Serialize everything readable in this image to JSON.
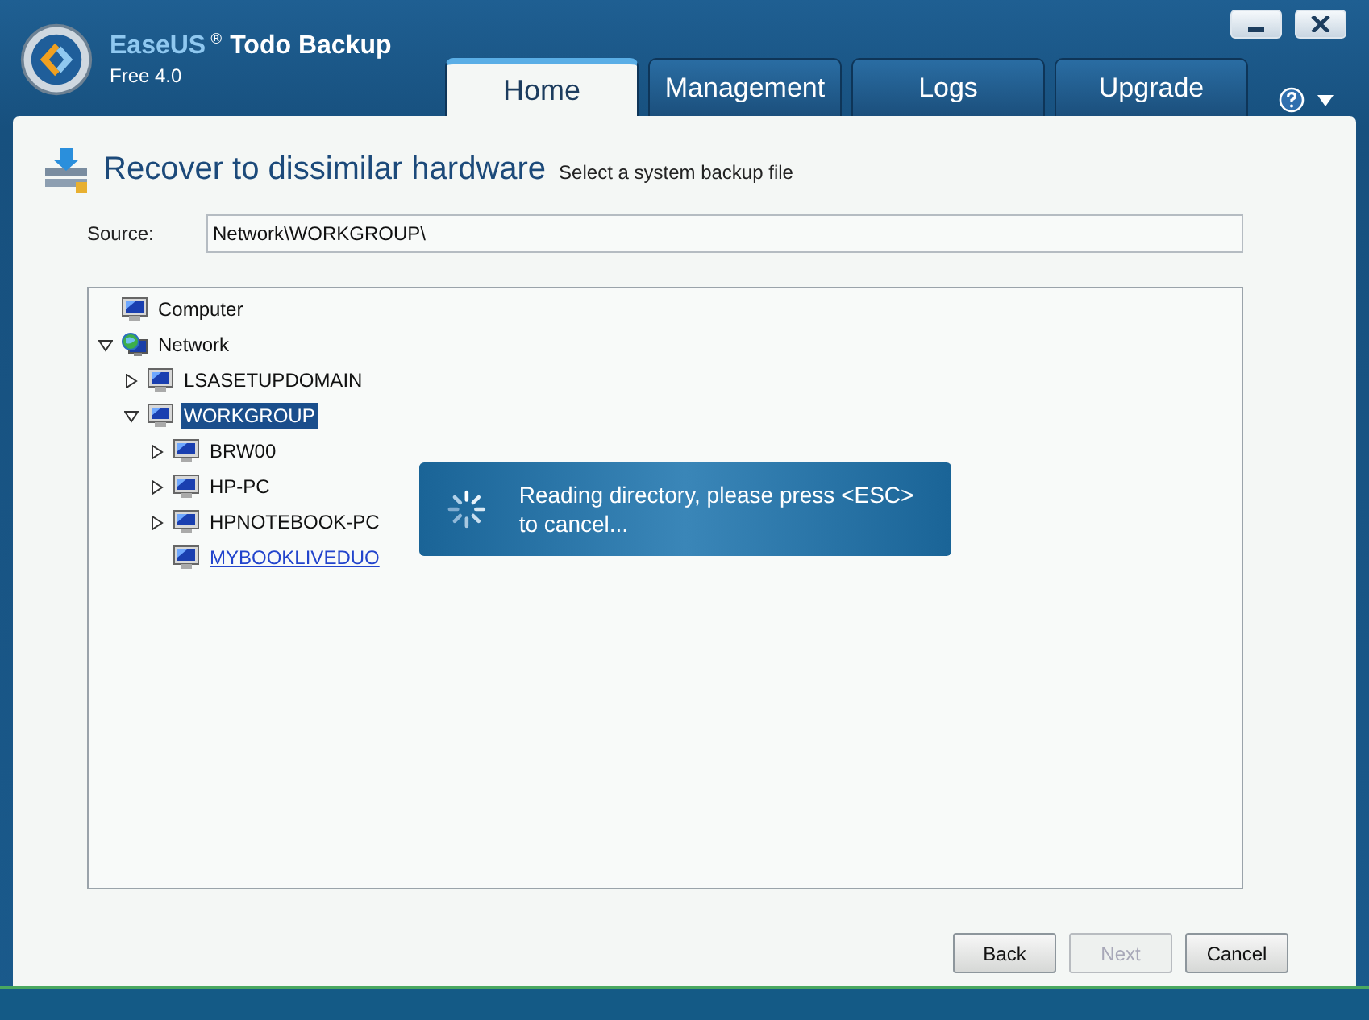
{
  "app": {
    "brand": "EaseUS",
    "product": "Todo Backup",
    "mark": "®",
    "edition": "Free 4.0"
  },
  "tabs": [
    {
      "label": "Home",
      "selected": true
    },
    {
      "label": "Management",
      "selected": false
    },
    {
      "label": "Logs",
      "selected": false
    },
    {
      "label": "Upgrade",
      "selected": false
    }
  ],
  "page": {
    "title": "Recover to dissimilar hardware",
    "subtitle": "Select a system backup file"
  },
  "source": {
    "label": "Source:",
    "value": "Network\\WORKGROUP\\"
  },
  "tree": [
    {
      "label": "Computer",
      "kind": "computer",
      "selected": false
    },
    {
      "label": "Network",
      "kind": "network",
      "selected": false,
      "expanded": true,
      "children": [
        {
          "label": "LSASETUPDOMAIN",
          "kind": "computer",
          "selected": false,
          "expanded": false
        },
        {
          "label": "WORKGROUP",
          "kind": "computer",
          "selected": true,
          "expanded": true,
          "children": [
            {
              "label": "BRW00",
              "kind": "computer",
              "selected": false,
              "expanded": false
            },
            {
              "label": "HP-PC",
              "kind": "computer",
              "selected": false,
              "expanded": false
            },
            {
              "label": "HPNOTEBOOK-PC",
              "kind": "computer",
              "selected": false,
              "expanded": false
            },
            {
              "label": "MYBOOKLIVEDUO",
              "kind": "link",
              "selected": false
            }
          ]
        }
      ]
    }
  ],
  "progress": {
    "message": "Reading directory, please press <ESC> to cancel..."
  },
  "buttons": [
    {
      "label": "Back",
      "disabled": false
    },
    {
      "label": "Next",
      "disabled": true
    },
    {
      "label": "Cancel",
      "disabled": false
    }
  ]
}
